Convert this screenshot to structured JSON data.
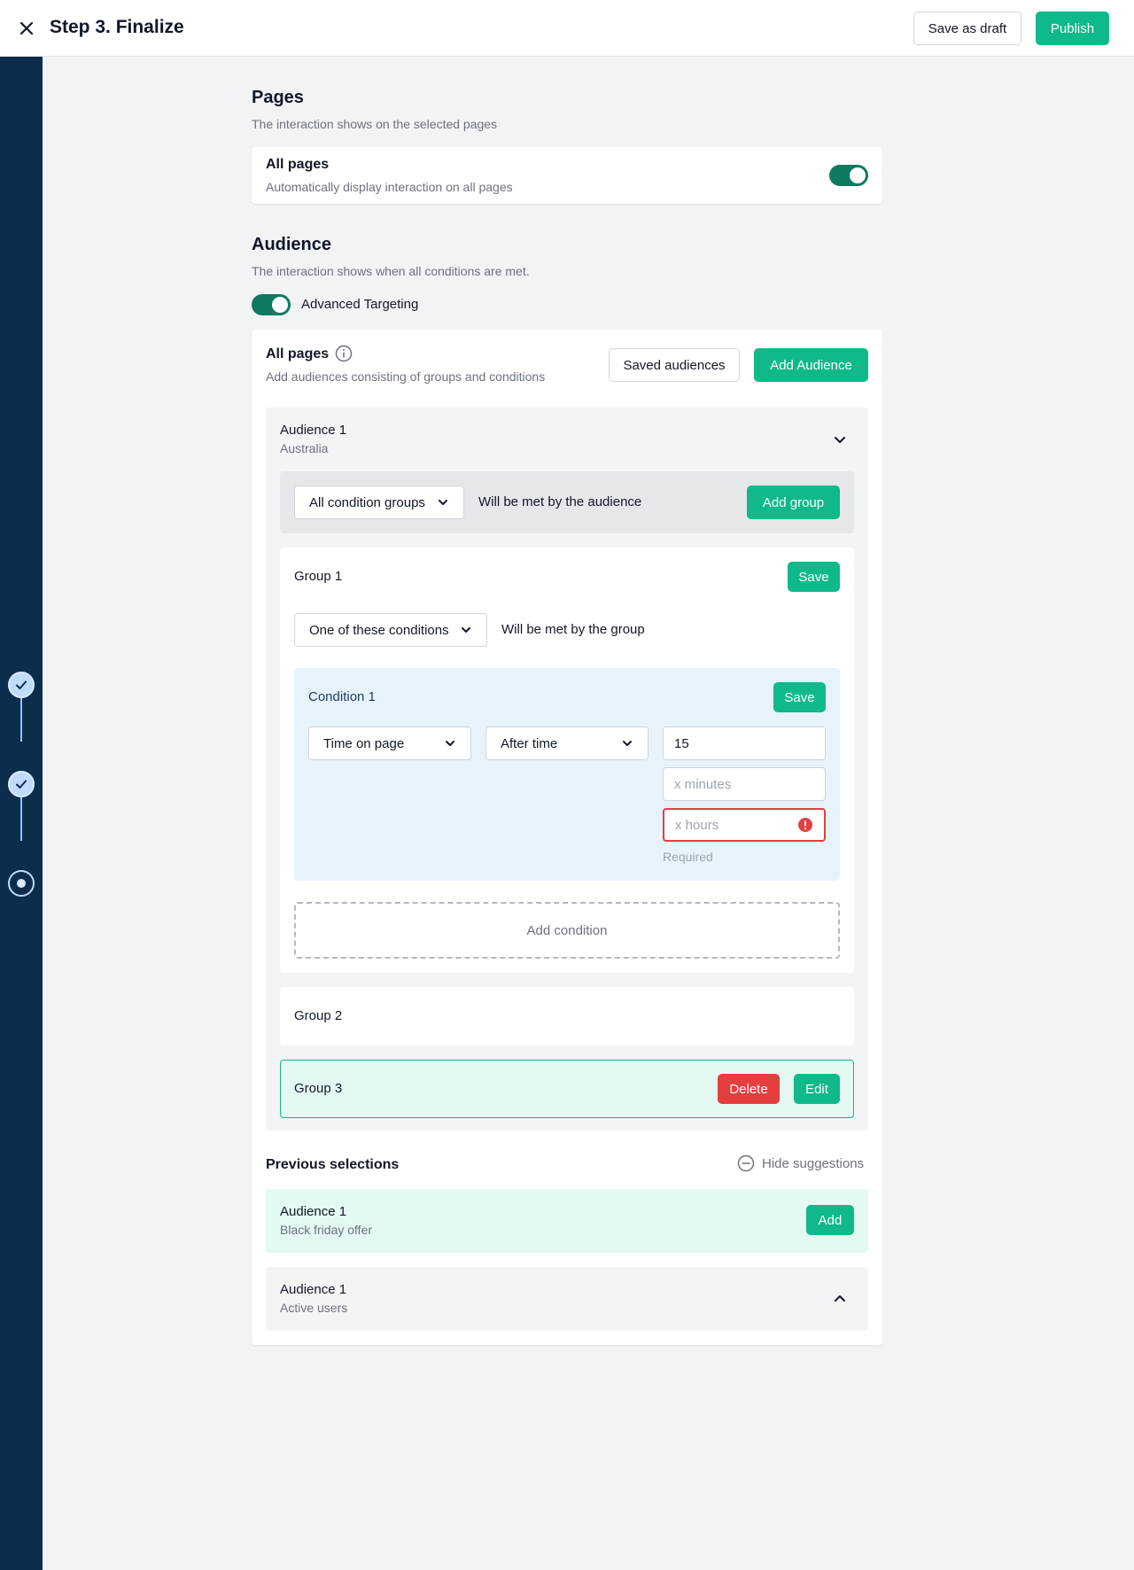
{
  "header": {
    "title": "Step 3. Finalize",
    "save_draft_label": "Save as draft",
    "publish_label": "Publish"
  },
  "pages": {
    "title": "Pages",
    "subtitle": "The interaction shows on the selected pages",
    "all_pages": {
      "title": "All pages",
      "description": "Automatically display interaction on all pages",
      "enabled": true
    }
  },
  "audience": {
    "title": "Audience",
    "subtitle": "The interaction shows when all conditions are met.",
    "advanced_targeting_label": "Advanced Targeting",
    "advanced_targeting_enabled": true,
    "card": {
      "title": "All pages",
      "description": "Add audiences consisting of groups and conditions",
      "saved_audiences_label": "Saved audiences",
      "add_audience_label": "Add Audience"
    },
    "audience1": {
      "name": "Audience 1",
      "subtitle": "Australia",
      "groups_select": "All condition groups",
      "groups_text": "Will be met by the audience",
      "add_group_label": "Add group"
    },
    "group1": {
      "name": "Group 1",
      "save_label": "Save",
      "conditions_select": "One of these conditions",
      "conditions_text": "Will be met by the group",
      "condition1": {
        "name": "Condition 1",
        "save_label": "Save",
        "type_select": "Time on page",
        "operator_select": "After time",
        "value": "15",
        "minutes_placeholder": "x minutes",
        "hours_placeholder": "x hours",
        "error_text": "Required"
      },
      "add_condition_label": "Add condition"
    },
    "group2": {
      "name": "Group 2"
    },
    "group3": {
      "name": "Group 3",
      "delete_label": "Delete",
      "edit_label": "Edit"
    }
  },
  "previous": {
    "title": "Previous selections",
    "hide_label": "Hide suggestions",
    "items": [
      {
        "name": "Audience 1",
        "subtitle": "Black friday offer",
        "add_label": "Add"
      },
      {
        "name": "Audience 1",
        "subtitle": "Active users"
      }
    ]
  },
  "colors": {
    "primary": "#10b98a",
    "sidebar": "#0c2d4c",
    "danger": "#e53e3e",
    "condition_bg": "#e6f3fd",
    "selected_group_bg": "#e4f9f1"
  }
}
